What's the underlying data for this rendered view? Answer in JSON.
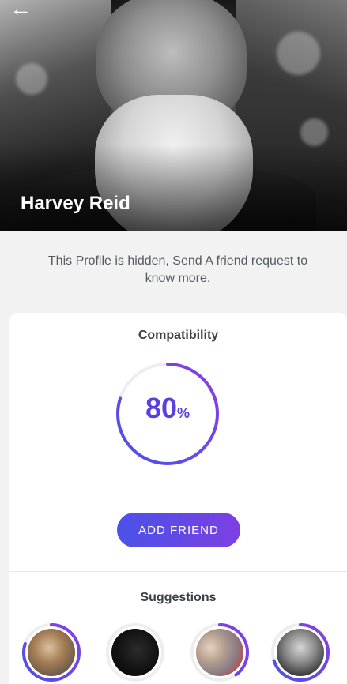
{
  "header": {
    "back_icon": "arrow-left-icon",
    "name": "Harvey Reid"
  },
  "profile": {
    "hidden_message": "This Profile is hidden, Send A friend request to know more."
  },
  "compatibility": {
    "title": "Compatibility",
    "value": "80",
    "unit": "%",
    "fraction": 0.8
  },
  "actions": {
    "add_friend_label": "ADD FRIEND"
  },
  "suggestions": {
    "title": "Suggestions",
    "items": [
      {
        "avatar": "suggestion-avatar-1",
        "fraction": 0.8
      },
      {
        "avatar": "suggestion-avatar-2",
        "fraction": 0.0
      },
      {
        "avatar": "suggestion-avatar-3",
        "fraction": 0.4
      },
      {
        "avatar": "suggestion-avatar-4",
        "fraction": 0.7
      }
    ]
  },
  "colors": {
    "accent_start": "#4a52e8",
    "accent_end": "#7d3fe3",
    "track": "#eeeeee",
    "background": "#f2f2f2"
  }
}
